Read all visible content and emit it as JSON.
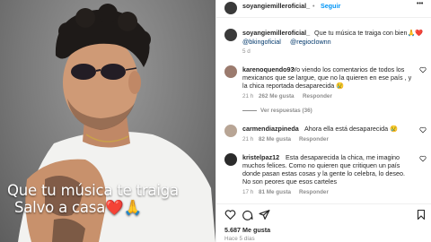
{
  "post": {
    "username": "soyangiemilleroficial_",
    "separator": "•",
    "follow_label": "Seguir",
    "more_label": "•••",
    "caption_text_lines": [
      "Que tu música te traiga",
      "Salvo a casa❤️🙏"
    ],
    "caption": {
      "username": "soyangiemilleroficial_",
      "text": "Que tu música te traiga con bien🙏❤️",
      "mention1": "@bkingoficial",
      "mention2": "@regioclownn",
      "time": "5 d"
    }
  },
  "comments": [
    {
      "username": "karenoquendo93",
      "lines": [
        "Yo viendo los comentarios de todos los",
        "mexicanos que se largue, que no la quieren en ese país , y",
        "la chica reportada desaparecida 😢"
      ],
      "time": "21 h",
      "likes": "262 Me gusta",
      "reply": "Responder",
      "view_replies": "Ver respuestas (36)"
    },
    {
      "username": "carmendiazpineda",
      "lines": [
        "Ahora ella está desaparecida 😢"
      ],
      "time": "21 h",
      "likes": "82 Me gusta",
      "reply": "Responder"
    },
    {
      "username": "kristelpaz12",
      "lines": [
        "Esta desaparecida la chica, me imagino",
        "muchos felices. Como no quieren que critiquen un país",
        "donde pasan estas cosas y la gente lo celebra, lo deseo.",
        "No son peores que esos carteles"
      ],
      "time": "17 h",
      "likes": "81 Me gusta",
      "reply": "Responder"
    }
  ],
  "footer": {
    "likes": "5.687 Me gusta",
    "time": "Hace 5 días"
  },
  "colors": {
    "accent": "#0095f6",
    "text": "#262626",
    "muted": "#8e8e8e"
  }
}
